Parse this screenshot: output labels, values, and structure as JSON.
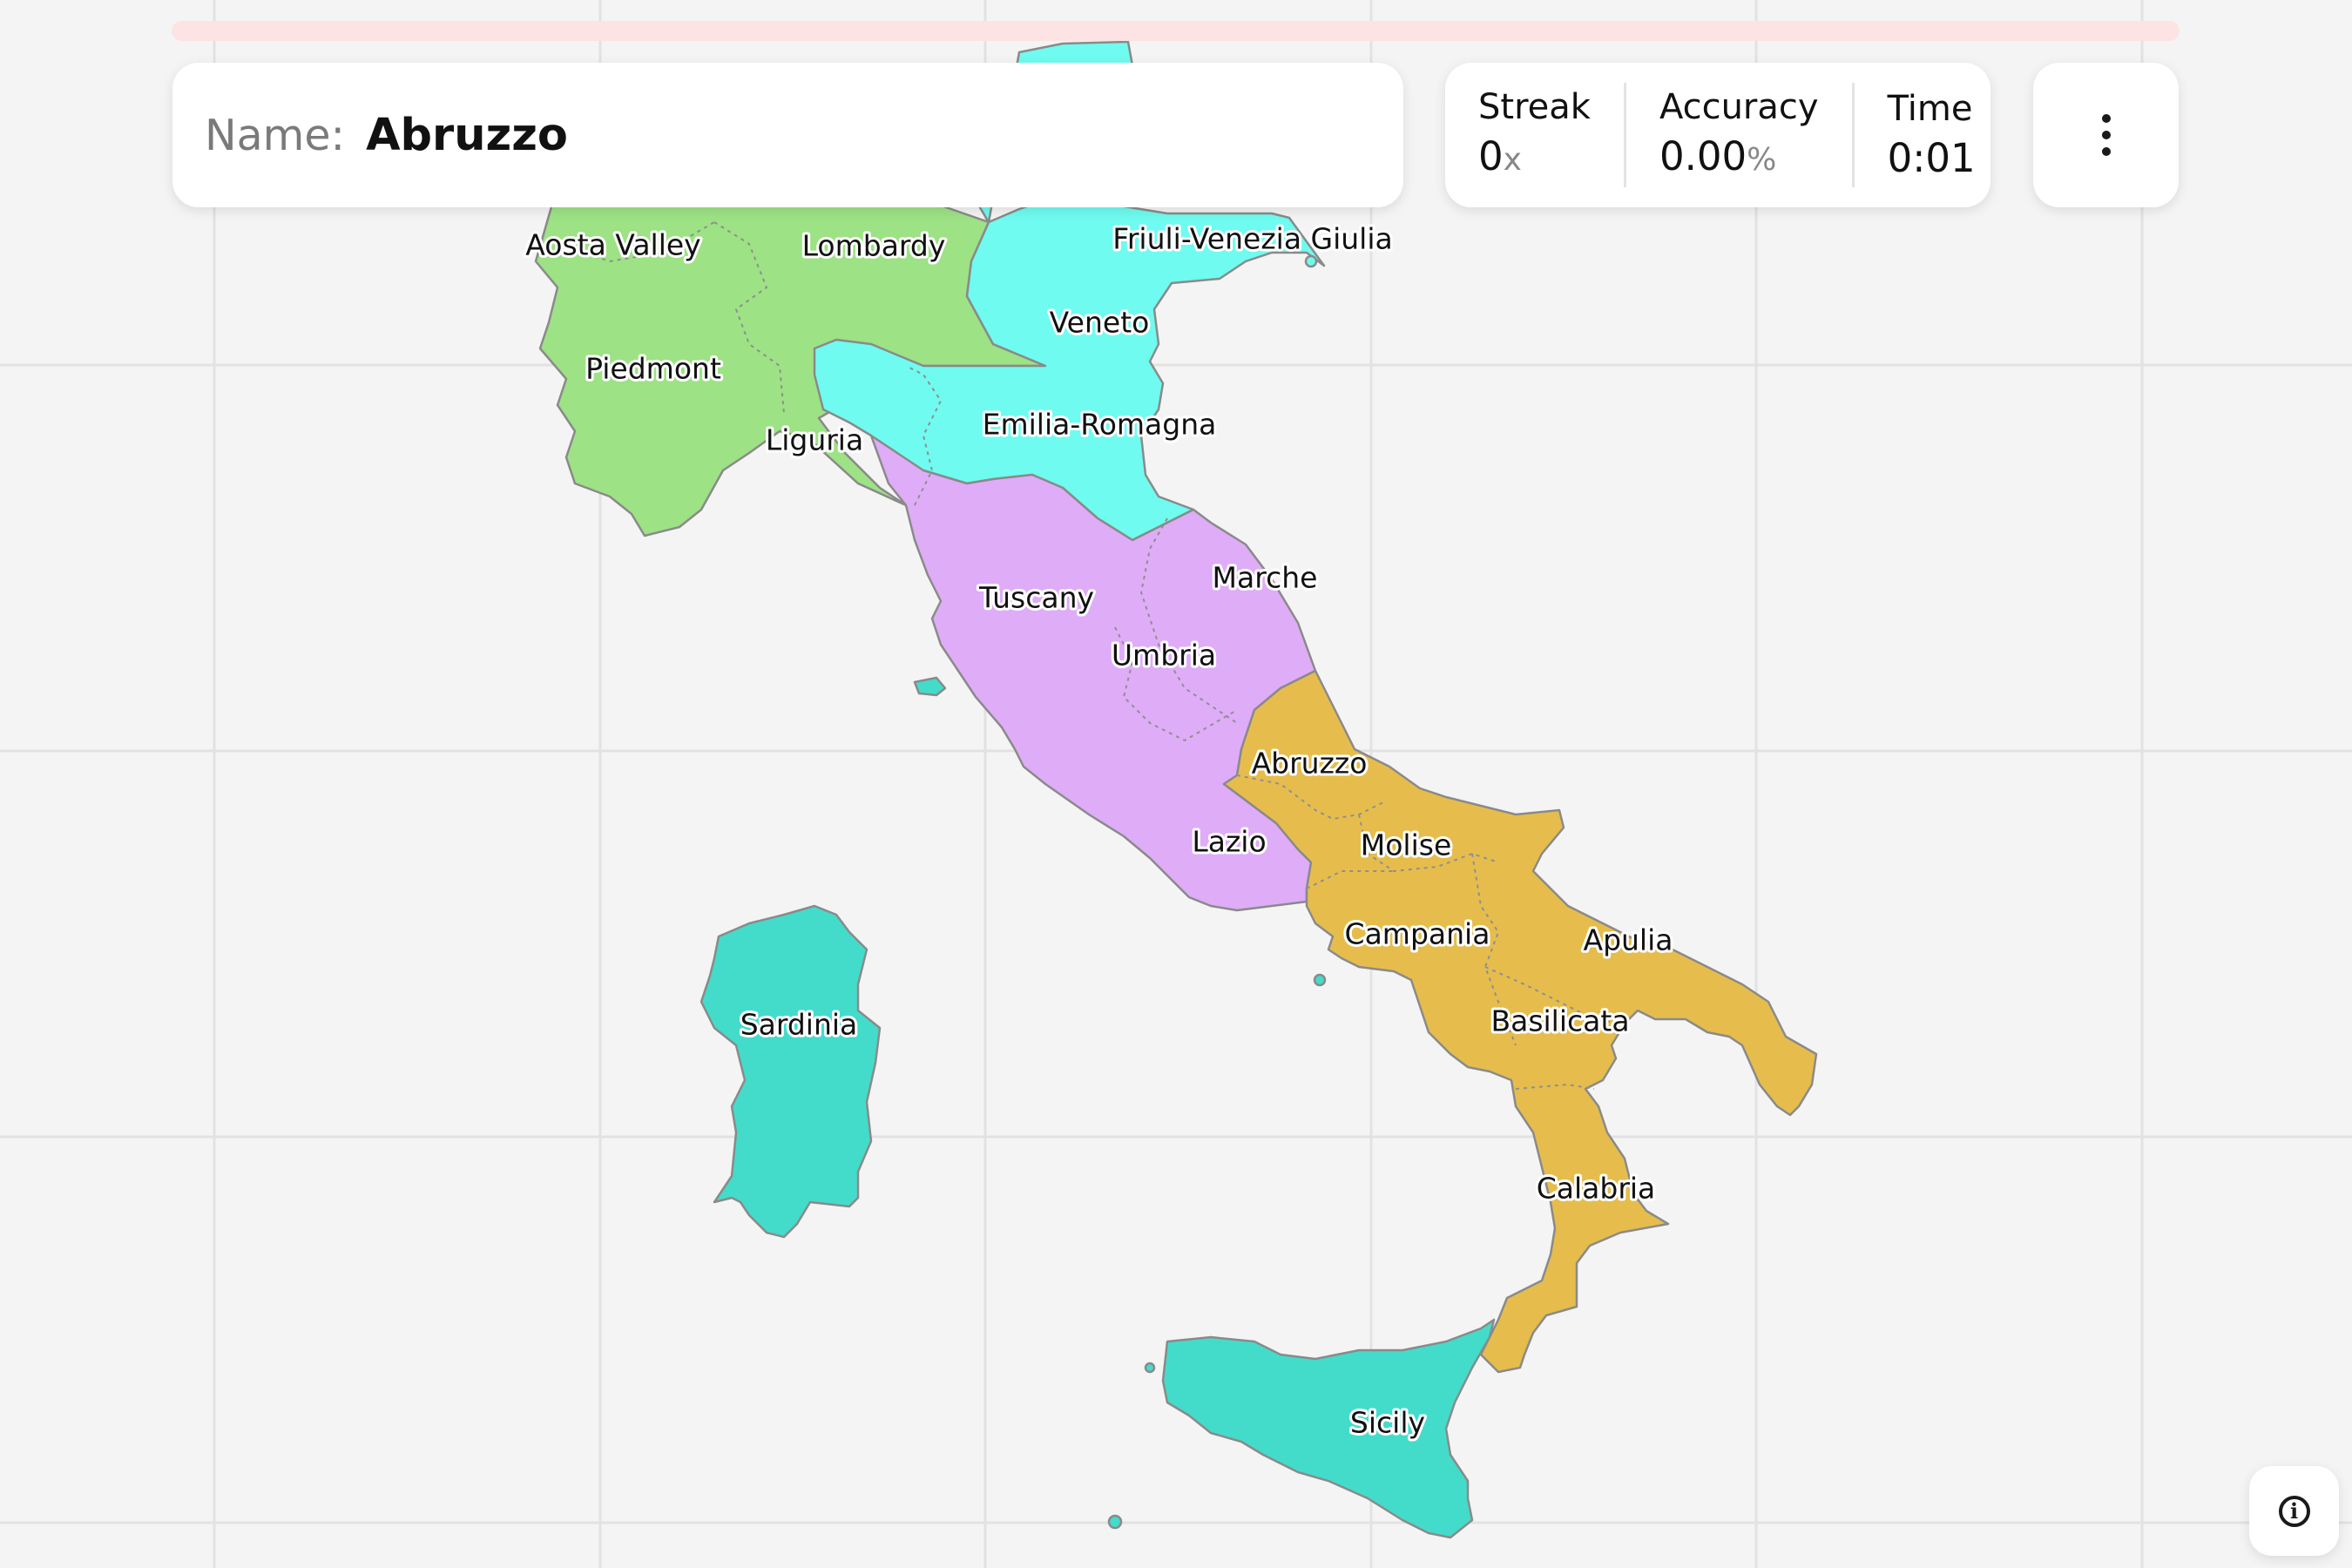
{
  "quiz": {
    "name_label": "Name:",
    "current_target": "Abruzzo",
    "progress_fraction": 0.0
  },
  "stats": {
    "streak_label": "Streak",
    "streak_value": "0",
    "streak_unit": "x",
    "accuracy_label": "Accuracy",
    "accuracy_value": "0.00",
    "accuracy_unit": "%",
    "time_label": "Time",
    "time_value": "0:01"
  },
  "menu": {
    "icon": "more-vertical-icon"
  },
  "info": {
    "icon": "info-icon",
    "glyph": "i"
  },
  "map": {
    "macro_region_colors": {
      "northwest": "#9de285",
      "northeast": "#6ffbf0",
      "center": "#dfacf8",
      "south": "#e6bd4c",
      "islands": "#43dcca"
    },
    "regions": [
      {
        "id": "aosta-valley",
        "label": "Aosta Valley",
        "group": "northwest"
      },
      {
        "id": "lombardy",
        "label": "Lombardy",
        "group": "northwest"
      },
      {
        "id": "friuli-venezia-giulia",
        "label": "Friuli-Venezia Giulia",
        "group": "northeast"
      },
      {
        "id": "veneto",
        "label": "Veneto",
        "group": "northeast"
      },
      {
        "id": "piedmont",
        "label": "Piedmont",
        "group": "northwest"
      },
      {
        "id": "emilia-romagna",
        "label": "Emilia-Romagna",
        "group": "northeast"
      },
      {
        "id": "liguria",
        "label": "Liguria",
        "group": "northwest"
      },
      {
        "id": "marche",
        "label": "Marche",
        "group": "center"
      },
      {
        "id": "tuscany",
        "label": "Tuscany",
        "group": "center"
      },
      {
        "id": "umbria",
        "label": "Umbria",
        "group": "center"
      },
      {
        "id": "abruzzo",
        "label": "Abruzzo",
        "group": "south"
      },
      {
        "id": "lazio",
        "label": "Lazio",
        "group": "center"
      },
      {
        "id": "molise",
        "label": "Molise",
        "group": "south"
      },
      {
        "id": "campania",
        "label": "Campania",
        "group": "south"
      },
      {
        "id": "apulia",
        "label": "Apulia",
        "group": "south"
      },
      {
        "id": "basilicata",
        "label": "Basilicata",
        "group": "south"
      },
      {
        "id": "sardinia",
        "label": "Sardinia",
        "group": "islands"
      },
      {
        "id": "calabria",
        "label": "Calabria",
        "group": "south"
      },
      {
        "id": "sicily",
        "label": "Sicily",
        "group": "islands"
      }
    ]
  }
}
